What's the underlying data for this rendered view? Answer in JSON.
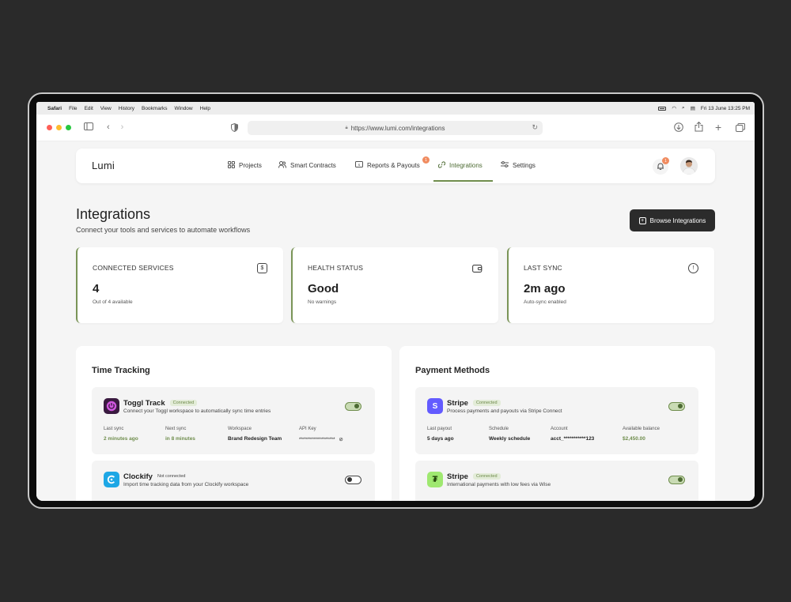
{
  "menubar": {
    "items": [
      "Safari",
      "File",
      "Edit",
      "View",
      "History",
      "Bookmarks",
      "Window",
      "Help"
    ],
    "datetime": "Fri 13 June  13:25 PM"
  },
  "browser": {
    "url": "https://www.lumi.com/integrations"
  },
  "nav": {
    "logo": "Lumi",
    "items": [
      {
        "label": "Projects",
        "icon": "grid-icon"
      },
      {
        "label": "Smart Contracts",
        "icon": "users-icon"
      },
      {
        "label": "Reports & Payouts",
        "icon": "report-icon",
        "badge": "1"
      },
      {
        "label": "Integrations",
        "icon": "link-icon",
        "active": true
      },
      {
        "label": "Settings",
        "icon": "sliders-icon"
      }
    ],
    "notification_count": "1"
  },
  "header": {
    "title": "Integrations",
    "subtitle": "Connect your tools and services to automate workflows",
    "browse_button": "Browse Integrations"
  },
  "stats": [
    {
      "label": "CONNECTED SERVICES",
      "value": "4",
      "note": "Out of 4 available",
      "icon": "dollar-icon"
    },
    {
      "label": "HEALTH STATUS",
      "value": "Good",
      "note": "No warnings",
      "icon": "wallet-icon"
    },
    {
      "label": "LAST SYNC",
      "value": "2m ago",
      "note": "Auto-sync enabled",
      "icon": "alert-icon"
    }
  ],
  "time_tracking": {
    "title": "Time Tracking",
    "services": [
      {
        "name": "Toggl Track",
        "status": "Connected",
        "description": "Connect your Toggl workspace to automatically sync time entries",
        "enabled": true,
        "fields": [
          {
            "label": "Last sync",
            "value": "2 minutes ago"
          },
          {
            "label": "Next sync",
            "value": "in 8 minutes"
          },
          {
            "label": "Workspace",
            "value": "Brand Redesign Team"
          },
          {
            "label": "API Key",
            "value": "******************"
          }
        ]
      },
      {
        "name": "Clockify",
        "status": "Not connected",
        "description": "Import time tracking data from your Clockify workspace",
        "enabled": false
      }
    ]
  },
  "payment_methods": {
    "title": "Payment Methods",
    "services": [
      {
        "name": "Stripe",
        "status": "Connected",
        "description": "Process payments and payouts via Stripe Connect",
        "enabled": true,
        "fields": [
          {
            "label": "Last payout",
            "value": "5 days ago"
          },
          {
            "label": "Schedule",
            "value": "Weekly schedule"
          },
          {
            "label": "Account",
            "value": "acct_***********123"
          },
          {
            "label": "Available balance",
            "value": "$2,450.00"
          }
        ]
      },
      {
        "name": "Stripe",
        "status": "Connected",
        "description": "International payments with low fees via Wise",
        "enabled": true
      }
    ]
  },
  "colors": {
    "accent": "#6f8d4d",
    "toggl": "#c23fd3",
    "clockify": "#1ea7e5",
    "stripe": "#635bff",
    "wise": "#9fe870",
    "badge": "#f08b5f"
  }
}
